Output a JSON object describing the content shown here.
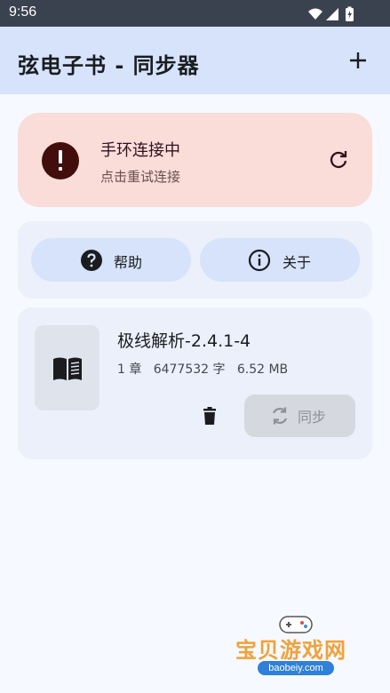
{
  "status_bar": {
    "time": "9:56"
  },
  "app_bar": {
    "title": "弦电子书 - 同步器",
    "add_icon": "plus-icon"
  },
  "connection": {
    "title": "手环连接中",
    "subtitle": "点击重试连接",
    "status_icon": "error-icon",
    "action_icon": "refresh-icon",
    "color": "#fadcd9"
  },
  "buttons": {
    "help_label": "帮助",
    "about_label": "关于"
  },
  "book": {
    "title": "极线解析-2.4.1-4",
    "meta": "1 章   6477532 字   6.52 MB",
    "sync_label": "同步",
    "delete_icon": "trash-icon"
  },
  "watermark": {
    "text": "宝贝游戏网",
    "url": "baobeiy.com"
  },
  "colors": {
    "accent": "#d6e3fa",
    "surface": "#ebf0fb",
    "error": "#3e0a0a"
  }
}
